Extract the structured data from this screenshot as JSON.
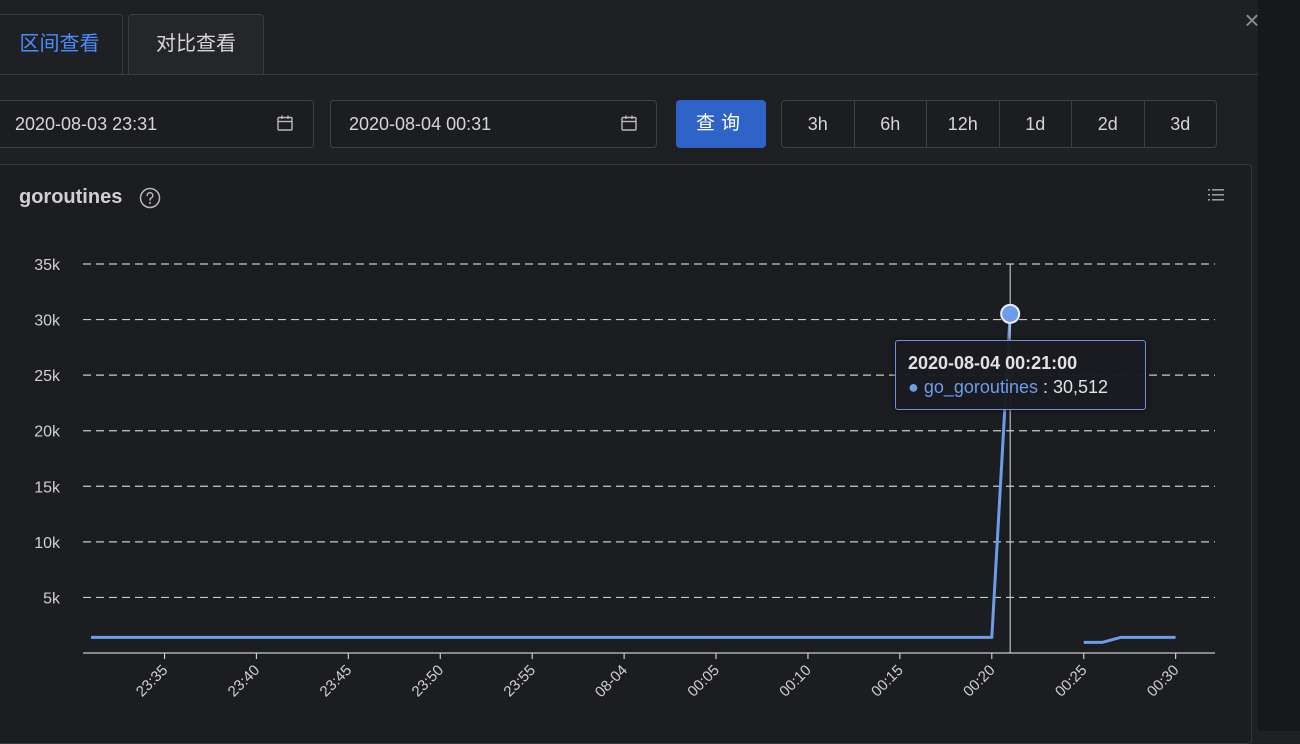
{
  "tabs": [
    {
      "label": "区间查看",
      "active": true
    },
    {
      "label": "对比查看",
      "active": false
    }
  ],
  "toolbar": {
    "start_date": "2020-08-03 23:31",
    "end_date": "2020-08-04 00:31",
    "query_label": "查询",
    "ranges": [
      "3h",
      "6h",
      "12h",
      "1d",
      "2d",
      "3d"
    ]
  },
  "panel": {
    "title": "goroutines",
    "help_icon": "question-circle-icon",
    "menu_icon": "list-icon"
  },
  "tooltip": {
    "time": "2020-08-04 00:21:00",
    "series": "go_goroutines",
    "value": "30,512"
  },
  "colors": {
    "accent": "#4a8bff",
    "line": "#6d9ceb",
    "button": "#2f63c7"
  },
  "chart_data": {
    "type": "line",
    "ylim": [
      0,
      35000
    ],
    "yticks": [
      5000,
      10000,
      15000,
      20000,
      25000,
      30000,
      35000
    ],
    "ytick_labels": [
      "5k",
      "10k",
      "15k",
      "20k",
      "25k",
      "30k",
      "35k"
    ],
    "xrange": [
      "23:31",
      "00:31"
    ],
    "xtick_labels": [
      "23:35",
      "23:40",
      "23:45",
      "23:50",
      "23:55",
      "08-04",
      "00:05",
      "00:10",
      "00:15",
      "00:20",
      "00:25",
      "00:30"
    ],
    "grid": true,
    "crosshair_x": "00:21",
    "series": [
      {
        "name": "go_goroutines",
        "segments": [
          [
            [
              "23:31",
              1400
            ],
            [
              "00:20",
              1400
            ],
            [
              "00:21",
              30512
            ]
          ],
          [
            [
              "00:25",
              950
            ],
            [
              "00:26",
              950
            ],
            [
              "00:27",
              1400
            ],
            [
              "00:30",
              1400
            ]
          ]
        ]
      }
    ]
  }
}
